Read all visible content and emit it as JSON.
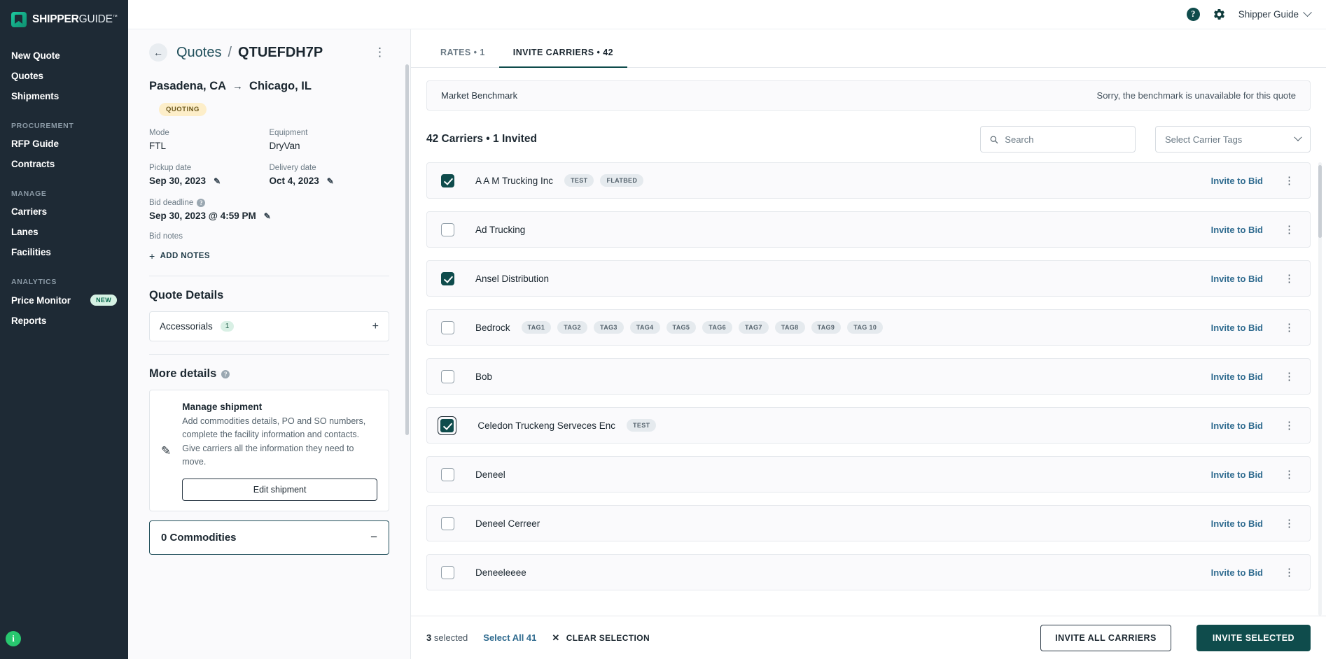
{
  "brand": {
    "name_bold": "SHIPPER",
    "name_light": "GUIDE",
    "tm": "™",
    "accent_color": "#0f4c4c",
    "sidebar_color": "#1e2a35"
  },
  "sidebar": {
    "primary": [
      {
        "label": "New Quote",
        "icon": "new-quote"
      },
      {
        "label": "Quotes",
        "icon": "quotes"
      },
      {
        "label": "Shipments",
        "icon": "shipments"
      }
    ],
    "sections": [
      {
        "title": "PROCUREMENT",
        "items": [
          {
            "label": "RFP Guide"
          },
          {
            "label": "Contracts"
          }
        ]
      },
      {
        "title": "MANAGE",
        "items": [
          {
            "label": "Carriers"
          },
          {
            "label": "Lanes"
          },
          {
            "label": "Facilities"
          }
        ]
      },
      {
        "title": "ANALYTICS",
        "items": [
          {
            "label": "Price Monitor",
            "badge": "NEW"
          },
          {
            "label": "Reports"
          }
        ]
      }
    ],
    "info_fab": "i"
  },
  "topbar": {
    "help_icon": "?",
    "gear_icon": "gear-icon",
    "user_name": "Shipper Guide"
  },
  "detail": {
    "back_icon": "←",
    "breadcrumb_parent": "Quotes",
    "breadcrumb_sep": "/",
    "breadcrumb_current": "QTUEFDH7P",
    "kebab": "⋮",
    "origin": "Pasadena, CA",
    "arrow": "→",
    "destination": "Chicago, IL",
    "status": "QUOTING",
    "fields": {
      "mode_label": "Mode",
      "mode_value": "FTL",
      "equipment_label": "Equipment",
      "equipment_value": "DryVan",
      "pickup_label": "Pickup date",
      "pickup_value": "Sep 30, 2023",
      "delivery_label": "Delivery date",
      "delivery_value": "Oct 4, 2023",
      "bid_deadline_label": "Bid deadline",
      "bid_deadline_value": "Sep 30, 2023 @ 4:59 PM",
      "bid_notes_label": "Bid notes",
      "add_notes": "ADD NOTES"
    },
    "quote_details_title": "Quote Details",
    "accessorials_label": "Accessorials",
    "accessorials_count": "1",
    "more_details_title": "More details",
    "manage_card": {
      "title": "Manage shipment",
      "body": "Add commodities details, PO and SO numbers, complete the facility information and contacts. Give carriers all the information they need to move.",
      "button": "Edit shipment"
    },
    "commodities_title": "0 Commodities",
    "commodities_toggle": "−"
  },
  "tabs": [
    {
      "label": "RATES • 1",
      "active": false
    },
    {
      "label": "INVITE CARRIERS • 42",
      "active": true
    }
  ],
  "benchmark": {
    "title": "Market Benchmark",
    "message": "Sorry, the benchmark is unavailable for this quote"
  },
  "list_header": {
    "count_text": "42 Carriers • 1 Invited",
    "search_placeholder": "Search",
    "search_value": "",
    "tag_select_label": "Select Carrier Tags"
  },
  "carriers": [
    {
      "name": "A A M Trucking Inc",
      "checked": true,
      "focused": false,
      "tags": [
        "TEST",
        "FLATBED"
      ],
      "action": "Invite to Bid"
    },
    {
      "name": "Ad Trucking",
      "checked": false,
      "focused": false,
      "tags": [],
      "action": "Invite to Bid"
    },
    {
      "name": "Ansel Distribution",
      "checked": true,
      "focused": false,
      "tags": [],
      "action": "Invite to Bid"
    },
    {
      "name": "Bedrock",
      "checked": false,
      "focused": false,
      "tags": [
        "TAG1",
        "TAG2",
        "TAG3",
        "TAG4",
        "TAG5",
        "TAG6",
        "TAG7",
        "TAG8",
        "TAG9",
        "TAG 10"
      ],
      "action": "Invite to Bid"
    },
    {
      "name": "Bob",
      "checked": false,
      "focused": false,
      "tags": [],
      "action": "Invite to Bid"
    },
    {
      "name": "Celedon Truckeng Serveces Enc",
      "checked": true,
      "focused": true,
      "tags": [
        "TEST"
      ],
      "action": "Invite to Bid"
    },
    {
      "name": "Deneel",
      "checked": false,
      "focused": false,
      "tags": [],
      "action": "Invite to Bid"
    },
    {
      "name": "Deneel Cerreer",
      "checked": false,
      "focused": false,
      "tags": [],
      "action": "Invite to Bid"
    },
    {
      "name": "Deneeleeee",
      "checked": false,
      "focused": false,
      "tags": [],
      "action": "Invite to Bid"
    }
  ],
  "footer": {
    "selected_count": "3",
    "selected_word": "selected",
    "select_all": "Select All 41",
    "clear_selection": "CLEAR SELECTION",
    "clear_icon": "✕",
    "invite_all": "INVITE ALL CARRIERS",
    "invite_selected": "INVITE SELECTED"
  }
}
